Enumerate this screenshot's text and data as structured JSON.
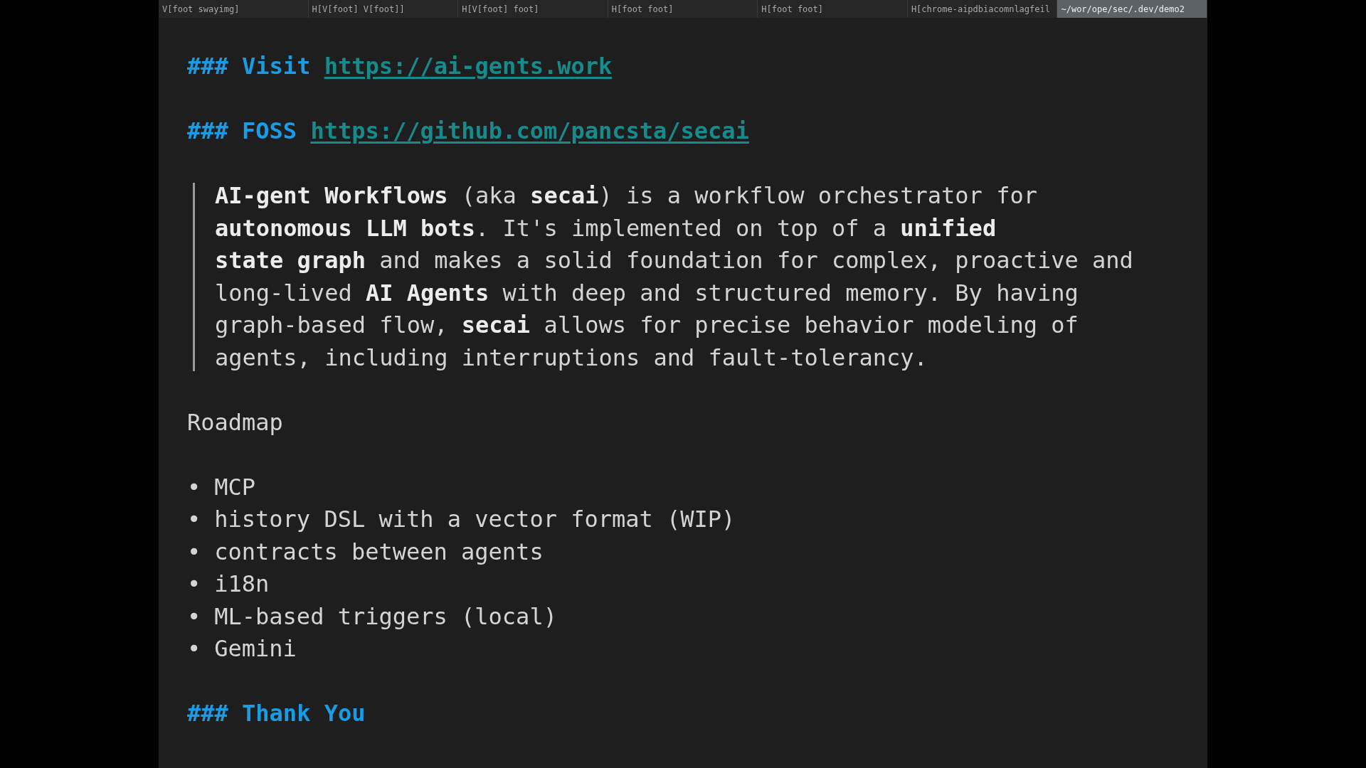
{
  "tabs": [
    {
      "label": "V[foot swayimg]",
      "selected": false
    },
    {
      "label": "H[V[foot] V[foot]]",
      "selected": false
    },
    {
      "label": "H[V[foot] foot]",
      "selected": false
    },
    {
      "label": "H[foot foot]",
      "selected": false
    },
    {
      "label": "H[foot foot]",
      "selected": false
    },
    {
      "label": "H[chrome-aipdbiacomnlagfeil",
      "selected": false
    },
    {
      "label": "~/wor/ope/sec/.dev/demo2",
      "selected": true
    }
  ],
  "content": [
    {
      "kind": "heading",
      "marker": "###",
      "text": "Visit",
      "link": "https://ai-gents.work"
    },
    {
      "kind": "blank"
    },
    {
      "kind": "heading",
      "marker": "###",
      "text": "FOSS",
      "link": "https://github.com/pancsta/secai"
    },
    {
      "kind": "blank"
    },
    {
      "kind": "quote",
      "lines": [
        "**AI-gent Workflows** (aka **secai**) is a workflow orchestrator for",
        "**autonomous LLM bots**. It's implemented on top of a **unified**",
        "**state graph** and makes a solid foundation for complex, proactive and",
        "long-lived **AI Agents** with deep and structured memory. By having",
        "graph-based flow, **secai** allows for precise behavior modeling of",
        "agents, including interruptions and fault-tolerancy."
      ]
    },
    {
      "kind": "blank"
    },
    {
      "kind": "text",
      "text": "Roadmap"
    },
    {
      "kind": "blank"
    },
    {
      "kind": "list",
      "bullet": "•",
      "items": [
        "MCP",
        "history DSL with a vector format (WIP)",
        "contracts between agents",
        "i18n",
        "ML-based triggers (local)",
        "Gemini"
      ]
    },
    {
      "kind": "blank"
    },
    {
      "kind": "heading",
      "marker": "###",
      "text": "Thank You"
    }
  ]
}
